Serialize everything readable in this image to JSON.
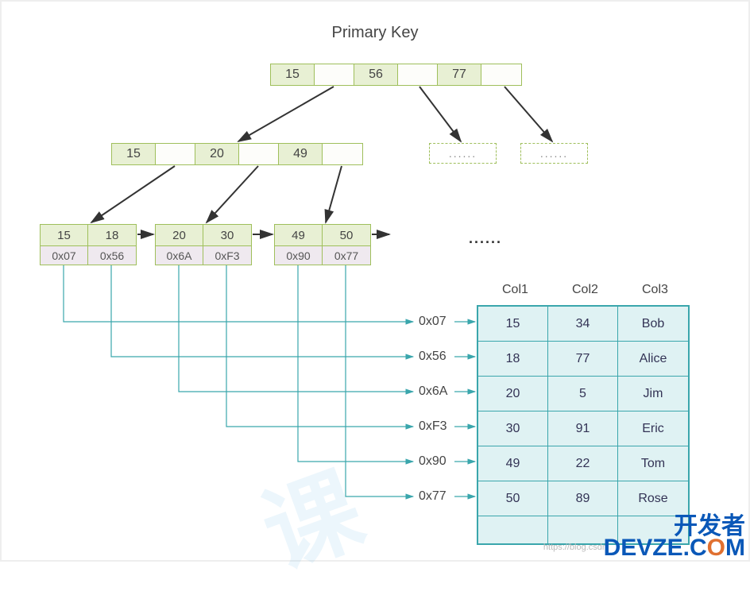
{
  "title": "Primary Key",
  "root": {
    "cells": [
      "15",
      "",
      "56",
      "",
      "77",
      ""
    ]
  },
  "internal": {
    "cells": [
      "15",
      "",
      "20",
      "",
      "49",
      ""
    ]
  },
  "dashed_label": "......",
  "leaves": [
    {
      "keys": [
        "15",
        "18"
      ],
      "ptrs": [
        "0x07",
        "0x56"
      ]
    },
    {
      "keys": [
        "20",
        "30"
      ],
      "ptrs": [
        "0x6A",
        "0xF3"
      ]
    },
    {
      "keys": [
        "49",
        "50"
      ],
      "ptrs": [
        "0x90",
        "0x77"
      ]
    }
  ],
  "leaf_ellipsis": "......",
  "addresses": [
    "0x07",
    "0x56",
    "0x6A",
    "0xF3",
    "0x90",
    "0x77"
  ],
  "table": {
    "headers": [
      "Col1",
      "Col2",
      "Col3"
    ],
    "rows": [
      [
        "15",
        "34",
        "Bob"
      ],
      [
        "18",
        "77",
        "Alice"
      ],
      [
        "20",
        "5",
        "Jim"
      ],
      [
        "30",
        "91",
        "Eric"
      ],
      [
        "49",
        "22",
        "Tom"
      ],
      [
        "50",
        "89",
        "Rose"
      ]
    ]
  },
  "watermarks": {
    "csdn": "https://blog.csdn",
    "devze_top": "开发者",
    "devze_bottom": "DEVZE.COM"
  },
  "chart_data": {
    "type": "diagram",
    "description": "B+Tree secondary index structure mapping primary key values through internal and leaf nodes to row pointers in a data table",
    "root_keys": [
      15,
      56,
      77
    ],
    "internal_keys": [
      15,
      20,
      49
    ],
    "leaf_nodes": [
      {
        "keys": [
          15,
          18
        ],
        "pointers": [
          "0x07",
          "0x56"
        ]
      },
      {
        "keys": [
          20,
          30
        ],
        "pointers": [
          "0x6A",
          "0xF3"
        ]
      },
      {
        "keys": [
          49,
          50
        ],
        "pointers": [
          "0x90",
          "0x77"
        ]
      }
    ],
    "row_pointers_order": [
      "0x07",
      "0x56",
      "0x6A",
      "0xF3",
      "0x90",
      "0x77"
    ],
    "data_rows": [
      {
        "Col1": 15,
        "Col2": 34,
        "Col3": "Bob"
      },
      {
        "Col1": 18,
        "Col2": 77,
        "Col3": "Alice"
      },
      {
        "Col1": 20,
        "Col2": 5,
        "Col3": "Jim"
      },
      {
        "Col1": 30,
        "Col2": 91,
        "Col3": "Eric"
      },
      {
        "Col1": 49,
        "Col2": 22,
        "Col3": "Tom"
      },
      {
        "Col1": 50,
        "Col2": 89,
        "Col3": "Rose"
      }
    ]
  }
}
